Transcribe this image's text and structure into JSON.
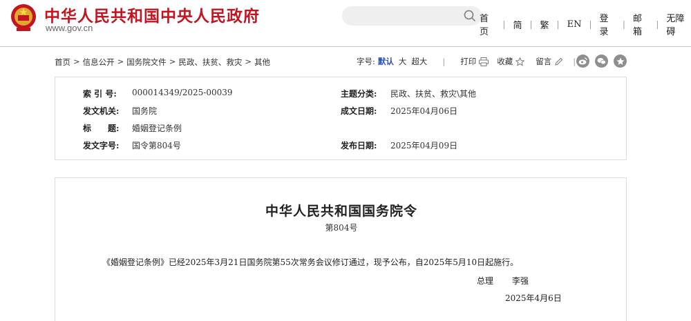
{
  "header": {
    "site_title": "中华人民共和国中央人民政府",
    "site_url": "www.gov.cn",
    "nav": [
      "首页",
      "简",
      "繁",
      "EN",
      "登录",
      "邮箱",
      "无障碍"
    ]
  },
  "breadcrumb": [
    "首页",
    "信息公开",
    "国务院文件",
    "民政、扶贫、救灾",
    "其他"
  ],
  "toolbar": {
    "font_size_label": "字号:",
    "font_sizes": [
      "默认",
      "大",
      "超大"
    ],
    "print_label": "打印",
    "favorite_label": "收藏",
    "comment_label": "留言"
  },
  "info": {
    "index_label": "索 引 号:",
    "index_value": "000014349/2025-00039",
    "topic_label": "主题分类:",
    "topic_value": "民政、扶贫、救灾\\其他",
    "issuer_label": "发文机关:",
    "issuer_value": "国务院",
    "written_label": "成文日期:",
    "written_value": "2025年04月06日",
    "title_label": "标　　题:",
    "title_value": "婚姻登记条例",
    "docno_label": "发文字号:",
    "docno_value": "国令第804号",
    "publish_label": "发布日期:",
    "publish_value": "2025年04月09日"
  },
  "document": {
    "title": "中华人民共和国国务院令",
    "number": "第804号",
    "paragraph": "《婚姻登记条例》已经2025年3月21日国务院第55次常务会议修订通过，现予公布，自2025年5月10日起施行。",
    "signer_title": "总理",
    "signer_name": "李强",
    "date": "2025年4月6日"
  },
  "colors": {
    "brand_red": "#c3151f",
    "active_blue": "#2b4fb3",
    "icon_gray": "#8e8e8e"
  }
}
